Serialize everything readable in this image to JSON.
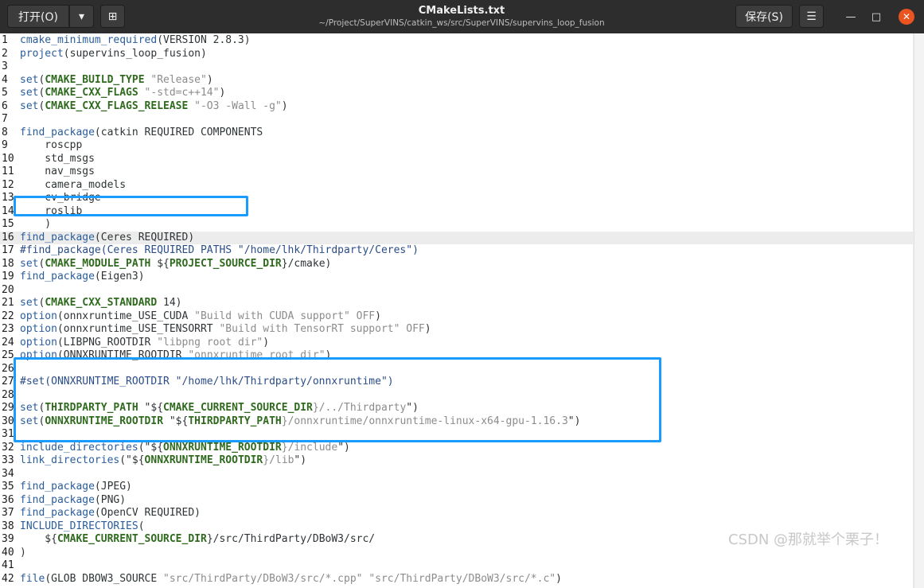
{
  "titlebar": {
    "open_label": "打开(O)",
    "open_menu_icon": "▾",
    "new_tab_icon": "⊞",
    "title": "CMakeLists.txt",
    "path": "~/Project/SuperVINS/catkin_ws/src/SuperVINS/supervins_loop_fusion",
    "save_label": "保存(S)",
    "menu_icon": "☰",
    "minimize_icon": "—",
    "maximize_icon": "□",
    "close_icon": "✕"
  },
  "editor": {
    "current_line": 16,
    "lines": [
      {
        "n": "1",
        "segs": [
          {
            "t": "cmake_minimum_required",
            "c": "fn"
          },
          {
            "t": "(VERSION 2.8.3)",
            "c": ""
          }
        ]
      },
      {
        "n": "2",
        "segs": [
          {
            "t": "project",
            "c": "fn"
          },
          {
            "t": "(supervins_loop_fusion)",
            "c": ""
          }
        ]
      },
      {
        "n": "3",
        "segs": []
      },
      {
        "n": "4",
        "segs": [
          {
            "t": "set",
            "c": "fn"
          },
          {
            "t": "(",
            "c": ""
          },
          {
            "t": "CMAKE_BUILD_TYPE",
            "c": "var"
          },
          {
            "t": " \"Release\"",
            "c": "str"
          },
          {
            "t": ")",
            "c": ""
          }
        ]
      },
      {
        "n": "5",
        "segs": [
          {
            "t": "set",
            "c": "fn"
          },
          {
            "t": "(",
            "c": ""
          },
          {
            "t": "CMAKE_CXX_FLAGS",
            "c": "var"
          },
          {
            "t": " \"-std=c++14\"",
            "c": "str"
          },
          {
            "t": ")",
            "c": ""
          }
        ]
      },
      {
        "n": "6",
        "segs": [
          {
            "t": "set",
            "c": "fn"
          },
          {
            "t": "(",
            "c": ""
          },
          {
            "t": "CMAKE_CXX_FLAGS_RELEASE",
            "c": "var"
          },
          {
            "t": " \"-O3 -Wall -g\"",
            "c": "str"
          },
          {
            "t": ")",
            "c": ""
          }
        ]
      },
      {
        "n": "7",
        "segs": []
      },
      {
        "n": "8",
        "segs": [
          {
            "t": "find_package",
            "c": "fn"
          },
          {
            "t": "(catkin REQUIRED COMPONENTS",
            "c": ""
          }
        ]
      },
      {
        "n": "9",
        "segs": [
          {
            "t": "    roscpp",
            "c": ""
          }
        ]
      },
      {
        "n": "10",
        "segs": [
          {
            "t": "    std_msgs",
            "c": ""
          }
        ]
      },
      {
        "n": "11",
        "segs": [
          {
            "t": "    nav_msgs",
            "c": ""
          }
        ]
      },
      {
        "n": "12",
        "segs": [
          {
            "t": "    camera_models",
            "c": ""
          }
        ]
      },
      {
        "n": "13",
        "segs": [
          {
            "t": "    cv_bridge",
            "c": ""
          }
        ]
      },
      {
        "n": "14",
        "segs": [
          {
            "t": "    roslib",
            "c": ""
          }
        ]
      },
      {
        "n": "15",
        "segs": [
          {
            "t": "    )",
            "c": ""
          }
        ]
      },
      {
        "n": "16",
        "segs": [
          {
            "t": "find_package",
            "c": "fn"
          },
          {
            "t": "(Ceres REQUIRED)",
            "c": ""
          }
        ]
      },
      {
        "n": "17",
        "segs": [
          {
            "t": "#find_package(Ceres REQUIRED PATHS \"/home/lhk/Thirdparty/Ceres\")",
            "c": "cmt"
          }
        ]
      },
      {
        "n": "18",
        "segs": [
          {
            "t": "set",
            "c": "fn"
          },
          {
            "t": "(",
            "c": ""
          },
          {
            "t": "CMAKE_MODULE_PATH",
            "c": "var"
          },
          {
            "t": " ${",
            "c": ""
          },
          {
            "t": "PROJECT_SOURCE_DIR",
            "c": "var"
          },
          {
            "t": "}/cmake)",
            "c": ""
          }
        ]
      },
      {
        "n": "19",
        "segs": [
          {
            "t": "find_package",
            "c": "fn"
          },
          {
            "t": "(Eigen3)",
            "c": ""
          }
        ]
      },
      {
        "n": "20",
        "segs": []
      },
      {
        "n": "21",
        "segs": [
          {
            "t": "set",
            "c": "fn"
          },
          {
            "t": "(",
            "c": ""
          },
          {
            "t": "CMAKE_CXX_STANDARD",
            "c": "var"
          },
          {
            "t": " 14)",
            "c": ""
          }
        ]
      },
      {
        "n": "22",
        "segs": [
          {
            "t": "option",
            "c": "fn"
          },
          {
            "t": "(onnxruntime_USE_CUDA ",
            "c": ""
          },
          {
            "t": "\"Build with CUDA support\" OFF",
            "c": "str"
          },
          {
            "t": ")",
            "c": ""
          }
        ]
      },
      {
        "n": "23",
        "segs": [
          {
            "t": "option",
            "c": "fn"
          },
          {
            "t": "(onnxruntime_USE_TENSORRT ",
            "c": ""
          },
          {
            "t": "\"Build with TensorRT support\" OFF",
            "c": "str"
          },
          {
            "t": ")",
            "c": ""
          }
        ]
      },
      {
        "n": "24",
        "segs": [
          {
            "t": "option",
            "c": "fn"
          },
          {
            "t": "(LIBPNG_ROOTDIR ",
            "c": ""
          },
          {
            "t": "\"libpng root dir\"",
            "c": "str"
          },
          {
            "t": ")",
            "c": ""
          }
        ]
      },
      {
        "n": "25",
        "segs": [
          {
            "t": "option",
            "c": "fn"
          },
          {
            "t": "(ONNXRUNTIME_ROOTDIR ",
            "c": ""
          },
          {
            "t": "\"onnxruntime root dir\"",
            "c": "str"
          },
          {
            "t": ")",
            "c": ""
          }
        ]
      },
      {
        "n": "26",
        "segs": []
      },
      {
        "n": "27",
        "segs": [
          {
            "t": "#set(ONNXRUNTIME_ROOTDIR \"/home/lhk/Thirdparty/onnxruntime\")",
            "c": "cmt"
          }
        ]
      },
      {
        "n": "28",
        "segs": []
      },
      {
        "n": "29",
        "segs": [
          {
            "t": "set",
            "c": "fn"
          },
          {
            "t": "(",
            "c": ""
          },
          {
            "t": "THIRDPARTY_PATH",
            "c": "var"
          },
          {
            "t": " \"${",
            "c": ""
          },
          {
            "t": "CMAKE_CURRENT_SOURCE_DIR",
            "c": "var"
          },
          {
            "t": "}/../Thirdparty",
            "c": "str"
          },
          {
            "t": "\")",
            "c": ""
          }
        ]
      },
      {
        "n": "30",
        "segs": [
          {
            "t": "set",
            "c": "fn"
          },
          {
            "t": "(",
            "c": ""
          },
          {
            "t": "ONNXRUNTIME_ROOTDIR",
            "c": "var"
          },
          {
            "t": " \"${",
            "c": ""
          },
          {
            "t": "THIRDPARTY_PATH",
            "c": "var"
          },
          {
            "t": "}/onnxruntime/onnxruntime-linux-x64-gpu-1.16.3",
            "c": "str"
          },
          {
            "t": "\")",
            "c": ""
          }
        ]
      },
      {
        "n": "31",
        "segs": []
      },
      {
        "n": "32",
        "segs": [
          {
            "t": "include_directories",
            "c": "fn"
          },
          {
            "t": "(\"${",
            "c": ""
          },
          {
            "t": "ONNXRUNTIME_ROOTDIR",
            "c": "var"
          },
          {
            "t": "}/include",
            "c": "str"
          },
          {
            "t": "\")",
            "c": ""
          }
        ]
      },
      {
        "n": "33",
        "segs": [
          {
            "t": "link_directories",
            "c": "fn"
          },
          {
            "t": "(\"${",
            "c": ""
          },
          {
            "t": "ONNXRUNTIME_ROOTDIR",
            "c": "var"
          },
          {
            "t": "}/lib",
            "c": "str"
          },
          {
            "t": "\")",
            "c": ""
          }
        ]
      },
      {
        "n": "34",
        "segs": []
      },
      {
        "n": "35",
        "segs": [
          {
            "t": "find_package",
            "c": "fn"
          },
          {
            "t": "(JPEG)",
            "c": ""
          }
        ]
      },
      {
        "n": "36",
        "segs": [
          {
            "t": "find_package",
            "c": "fn"
          },
          {
            "t": "(PNG)",
            "c": ""
          }
        ]
      },
      {
        "n": "37",
        "segs": [
          {
            "t": "find_package",
            "c": "fn"
          },
          {
            "t": "(OpenCV REQUIRED)",
            "c": ""
          }
        ]
      },
      {
        "n": "38",
        "segs": [
          {
            "t": "INCLUDE_DIRECTORIES",
            "c": "fn"
          },
          {
            "t": "(",
            "c": ""
          }
        ]
      },
      {
        "n": "39",
        "segs": [
          {
            "t": "    ${",
            "c": ""
          },
          {
            "t": "CMAKE_CURRENT_SOURCE_DIR",
            "c": "var"
          },
          {
            "t": "}/src/ThirdParty/DBoW3/src/",
            "c": ""
          }
        ]
      },
      {
        "n": "40",
        "segs": [
          {
            "t": ")",
            "c": ""
          }
        ]
      },
      {
        "n": "41",
        "segs": []
      },
      {
        "n": "42",
        "segs": [
          {
            "t": "file",
            "c": "fn"
          },
          {
            "t": "(GLOB DBOW3_SOURCE ",
            "c": ""
          },
          {
            "t": "\"src/ThirdParty/DBoW3/src/*.cpp\"",
            "c": "str"
          },
          {
            "t": " ",
            "c": ""
          },
          {
            "t": "\"src/ThirdParty/DBoW3/src/*.c\"",
            "c": "str"
          },
          {
            "t": ")",
            "c": ""
          }
        ]
      }
    ]
  },
  "watermark": "CSDN @那就举个栗子！",
  "colors": {
    "highlight_box": "#1a9bff",
    "function": "#2a5d9c",
    "variable": "#2f6a1e",
    "string": "#8c8c8c"
  }
}
